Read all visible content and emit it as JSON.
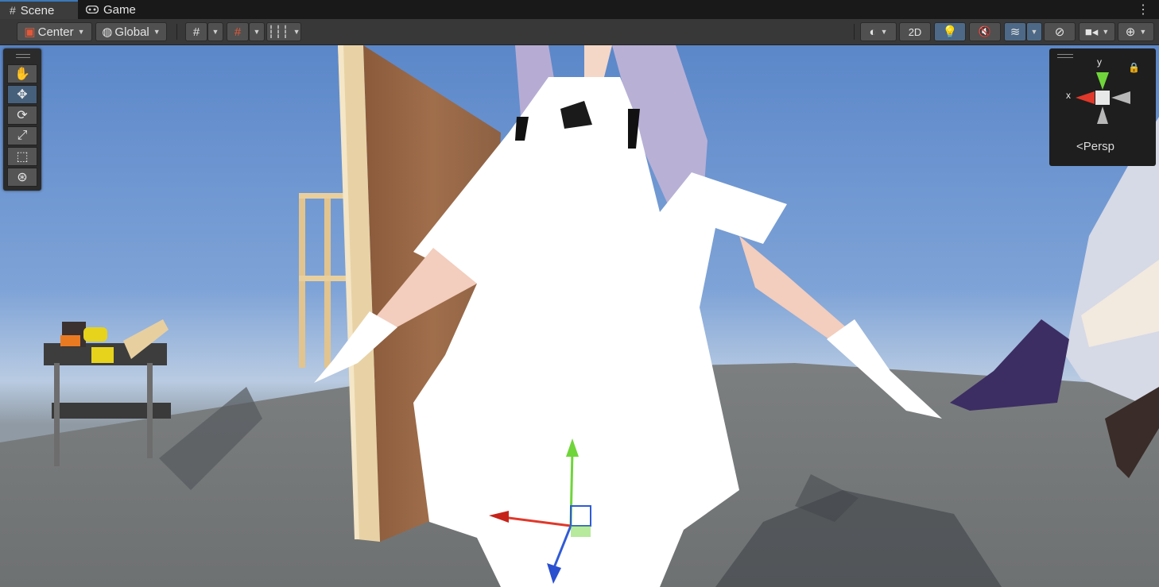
{
  "tabs": [
    {
      "label": "Scene",
      "icon": "scene-grid-icon",
      "active": true
    },
    {
      "label": "Game",
      "icon": "gamepad-icon",
      "active": false
    }
  ],
  "toolbar": {
    "pivot_label": "Center",
    "space_label": "Global",
    "mode_2d_label": "2D"
  },
  "gizmo": {
    "y_label": "y",
    "x_label": "x",
    "projection_label": "Persp"
  },
  "colors": {
    "accent": "#3a79bb",
    "selected": "#46607c",
    "x_axis": "#e0382a",
    "y_axis": "#6fd53a",
    "z_axis": "#2f5bd6"
  }
}
